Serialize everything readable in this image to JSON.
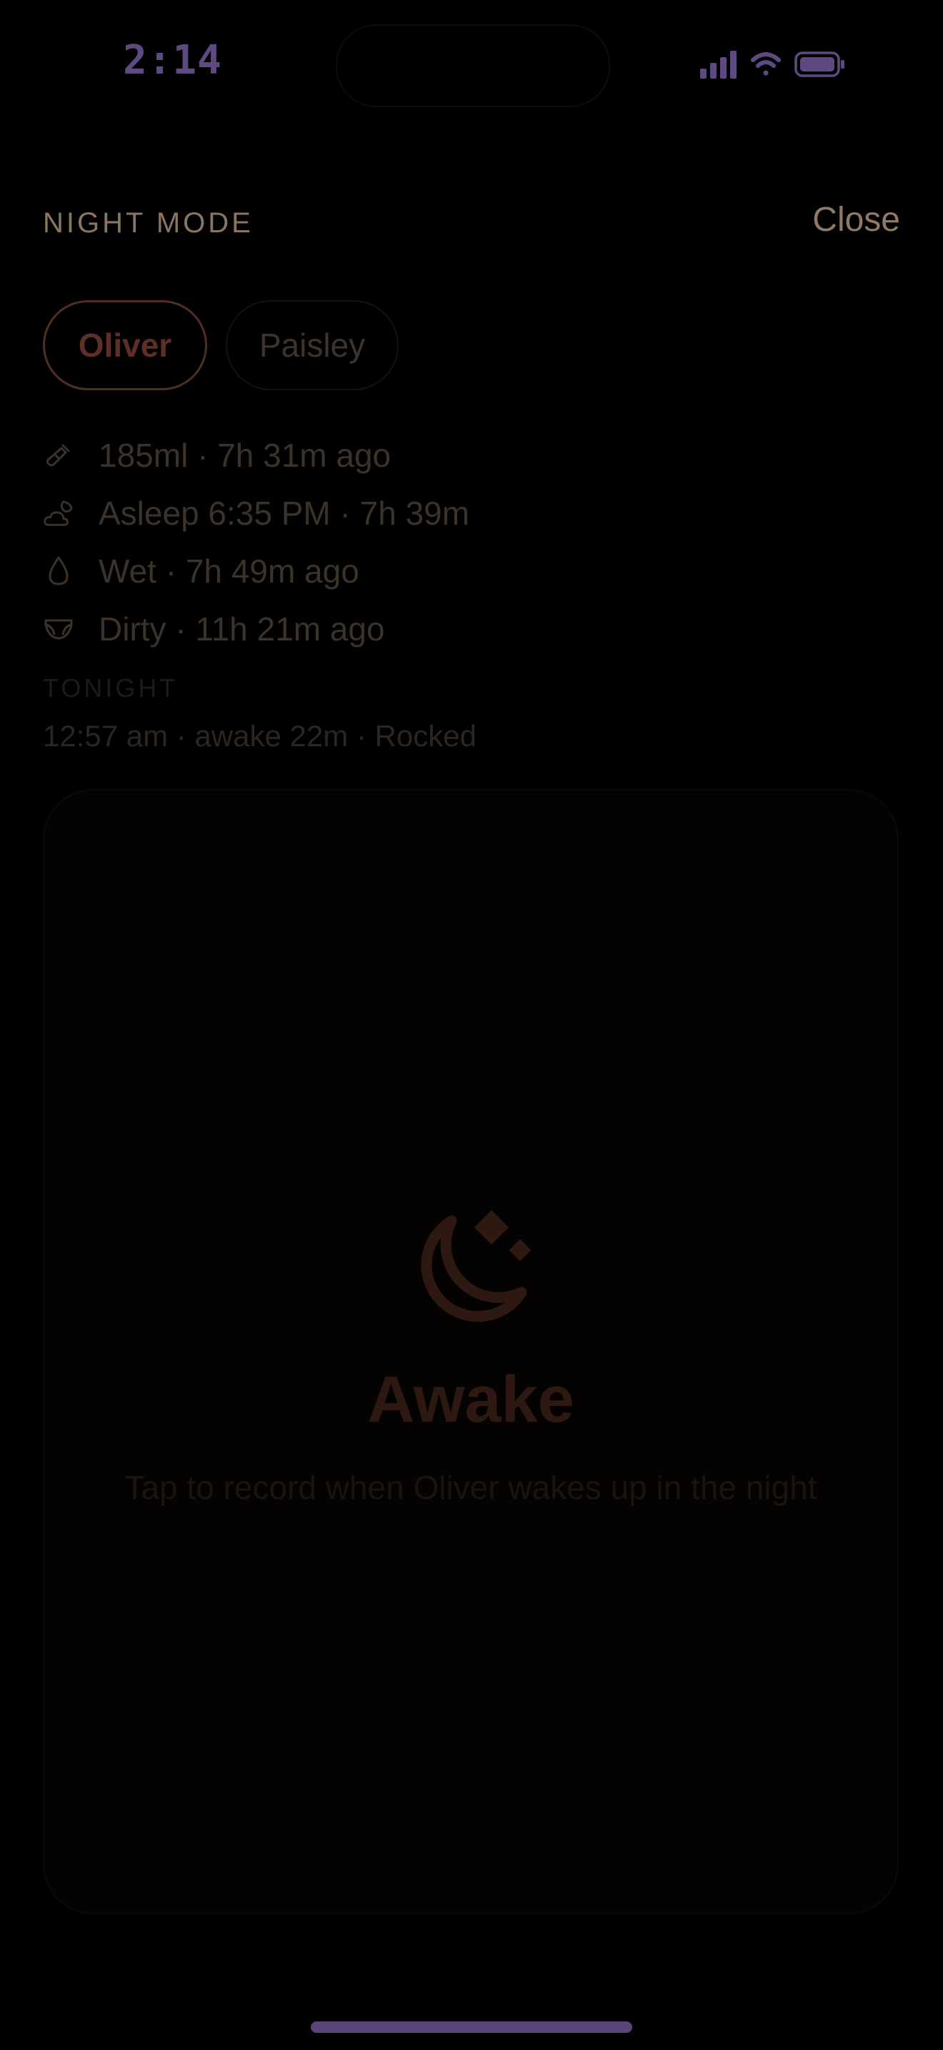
{
  "status_bar": {
    "time": "2:14",
    "accent_color": "#5e4a80"
  },
  "header": {
    "title": "NIGHT MODE",
    "close_label": "Close"
  },
  "tabs": [
    {
      "label": "Oliver",
      "active": true
    },
    {
      "label": "Paisley",
      "active": false
    }
  ],
  "stats": [
    {
      "icon": "bottle-icon",
      "text": "185ml · 7h 31m ago"
    },
    {
      "icon": "moon-cloud-icon",
      "text": "Asleep 6:35 PM · 7h 39m"
    },
    {
      "icon": "droplet-icon",
      "text": "Wet · 7h 49m ago"
    },
    {
      "icon": "diaper-icon",
      "text": "Dirty · 11h 21m ago"
    }
  ],
  "tonight": {
    "label": "TONIGHT",
    "entries": [
      "12:57 am · awake 22m · Rocked"
    ]
  },
  "card": {
    "icon": "moon-stars-icon",
    "title": "Awake",
    "subtitle": "Tap to record when Oliver wakes up in the night"
  }
}
